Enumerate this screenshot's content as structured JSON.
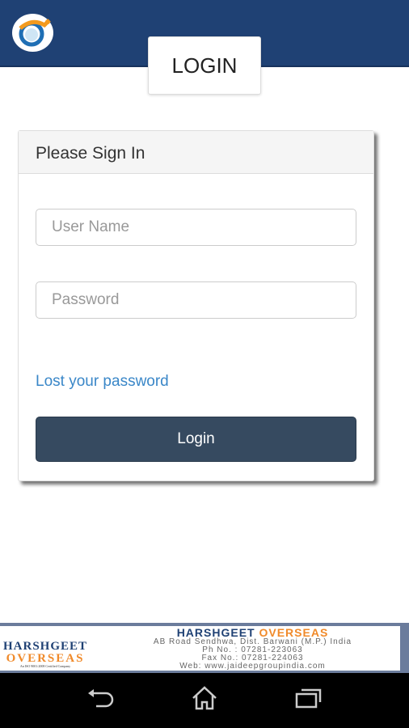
{
  "header": {
    "logo": "company-logo",
    "tab_label": "LOGIN"
  },
  "card": {
    "title": "Please Sign In",
    "username_placeholder": "User Name",
    "password_placeholder": "Password",
    "lost_password": "Lost your password",
    "login_button": "Login"
  },
  "banner": {
    "logo_line1": "HARSHGEET",
    "logo_line2": "OVERSEAS",
    "logo_tagline": "An ISO 9001:2008 Certified Company",
    "name_part1": "HARSHGEET",
    "name_part2": "OVERSEAS",
    "address": "AB Road Sendhwa, Dist. Barwani (M.P.) India",
    "phone": "Ph No. : 07281-223063",
    "fax": "Fax No.: 07281-224063",
    "web": "Web: www.jaideepgroupindia.com"
  },
  "navbar": {
    "back": "back-icon",
    "home": "home-icon",
    "recents": "recents-icon"
  },
  "colors": {
    "header": "#1f4174",
    "button": "#364a60",
    "link": "#3a87c8",
    "accent": "#f08a2a"
  }
}
